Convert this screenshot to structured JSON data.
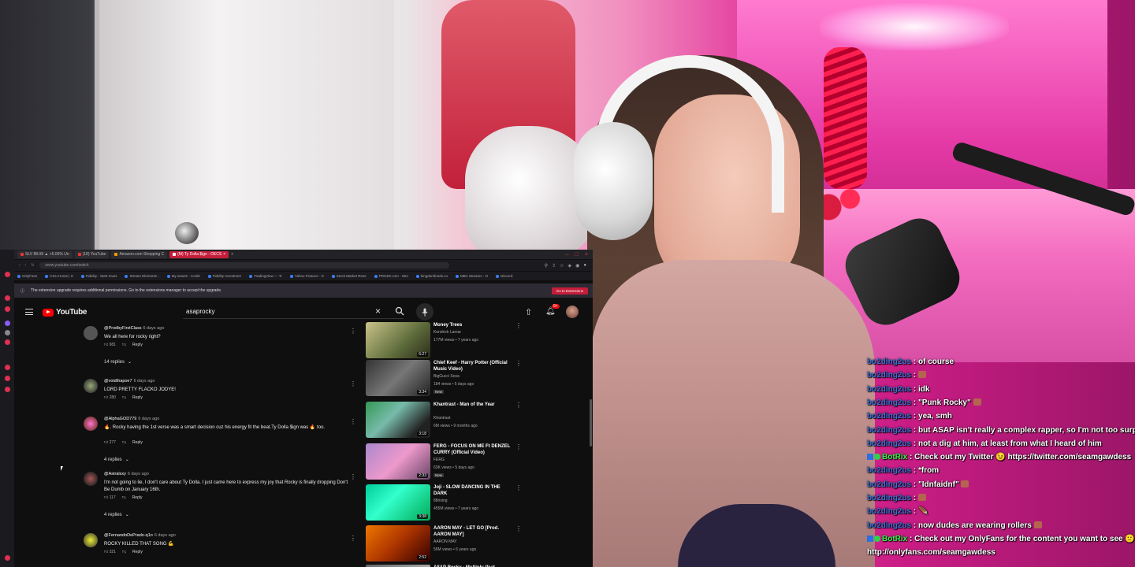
{
  "browser": {
    "tabs": [
      {
        "label": "SLV 88.08 ▲ +5.06% Un"
      },
      {
        "label": "(18) YouTube"
      },
      {
        "label": "Amazon.com Shopping C"
      },
      {
        "label": "(M) Ty Dolla $ign - DECS"
      }
    ],
    "url": "www.youtube.com/watch",
    "bookmarks": [
      "OnlyFans",
      "CSU Home | S",
      "Fidelity - Start Inves",
      "Stream Elements -",
      "My assets - Coinb",
      "Fidelity Investmen",
      "TradingView — Tr",
      "Yahoo Finance - S",
      "Stock Market Rese",
      "PROZZ.com - Stro",
      "kingdomfunds.co",
      "MBA Streams - O",
      "Discord"
    ],
    "notice": {
      "text": "The extension upgrade requires additional permissions. Go to the extensions manager to accept the upgrade.",
      "button": "Go to Extensions"
    }
  },
  "youtube": {
    "logo_text": "YouTube",
    "search_value": "asaprocky",
    "notification_count": "9+",
    "comments": [
      {
        "user": "@ProdbyFirstClass",
        "ago": "6 days ago",
        "text": "We all here for rocky right?",
        "likes": "981",
        "reply": "Reply",
        "replies": "14 replies"
      },
      {
        "user": "@voidthapoe7",
        "ago": "6 days ago",
        "text": "LORD PRETTY FLACKO JODYE!",
        "likes": "280",
        "reply": "Reply",
        "replies": ""
      },
      {
        "user": "@AlphaGOD779",
        "ago": "6 days ago",
        "text": "🔥. Rocky having the 1st verse was a smart decision cuz his energy fit the beat.Ty Dolla $ign was 🔥 too.",
        "likes": "277",
        "reply": "Reply",
        "replies": "4 replies"
      },
      {
        "user": "@Astralsxy",
        "ago": "6 days ago",
        "text": "I'm not going to lie, I don't care about Ty Dolla. I just came here to express my joy that Rocky is finally dropping Don't Be Dumb on January 16th.",
        "likes": "117",
        "reply": "Reply",
        "replies": "4 replies"
      },
      {
        "user": "@FernandoDePrado-q1o",
        "ago": "6 days ago",
        "text": "ROCKY KILLED THAT SONG 💪",
        "likes": "321",
        "reply": "Reply",
        "replies": ""
      }
    ],
    "recommendations": [
      {
        "title": "Money Trees",
        "channel": "Kendrick Lamar",
        "meta": "177M views • 7 years ago",
        "duration": "6:27",
        "is_new": false
      },
      {
        "title": "Chief Keef - Harry Potter (Official Music Video)",
        "channel": "BigGucci Sosa",
        "meta": "184 views • 5 days ago",
        "duration": "3:34",
        "is_new": true
      },
      {
        "title": "Khantrast - Man of the Year",
        "channel": "Khantrast",
        "meta": "6M views • 9 months ago",
        "duration": "3:18",
        "is_new": false
      },
      {
        "title": "FERG - FOCUS ON ME Ft DENZEL CURRY (Official Video)",
        "channel": "FERG",
        "meta": "63K views • 5 days ago",
        "duration": "2:33",
        "is_new": true
      },
      {
        "title": "Joji - SLOW DANCING IN THE DARK",
        "channel": "88rising",
        "meta": "455M views • 7 years ago",
        "duration": "3:38",
        "is_new": false
      },
      {
        "title": "AARON MAY - LET GO [Prod. AARON MAY]",
        "channel": "AARON MAY",
        "meta": "56M views • 6 years ago",
        "duration": "2:52",
        "is_new": false
      },
      {
        "title": "A$AP Rocky - Multiply (feat.",
        "channel": "",
        "meta": "",
        "duration": "",
        "is_new": false
      }
    ],
    "new_label": "New"
  },
  "chat": [
    {
      "user": "bo2ding2us",
      "text": " : of course"
    },
    {
      "user": "bo2ding2us",
      "text": " : "
    },
    {
      "user": "bo2ding2us",
      "text": " : idk"
    },
    {
      "user": "bo2ding2us",
      "text": " : \"Punk Rocky\" "
    },
    {
      "user": "bo2ding2us",
      "text": " : yea, smh"
    },
    {
      "user": "bo2ding2us",
      "text": " : but ASAP isn't really a complex rapper, so I'm not too surprised"
    },
    {
      "user": "bo2ding2us",
      "text": " : not a dig at him, at least from what I heard of him"
    },
    {
      "user": "BotRix",
      "text": " : Check out my Twitter 😉 https://twitter.com/seamgawdess",
      "bot": true
    },
    {
      "user": "bo2ding2us",
      "text": " : *from"
    },
    {
      "user": "bo2ding2us",
      "text": " : \"Idnfaidnf\" "
    },
    {
      "user": "bo2ding2us",
      "text": " : "
    },
    {
      "user": "bo2ding2us",
      "text": " : 🪶"
    },
    {
      "user": "bo2ding2us",
      "text": " : now dudes are wearing rollers "
    },
    {
      "user": "BotRix",
      "text": " : Check out my OnlyFans for the content you want to see 🙂",
      "bot": true
    },
    {
      "user": "",
      "text": "http://onlyfans.com/seamgawdess",
      "continuation": true
    }
  ],
  "colors": {
    "chat_user": "#3f6fd6",
    "chat_bot": "#3ef24d",
    "yt_red": "#ff0000",
    "browser_accent": "#c41d3a"
  }
}
